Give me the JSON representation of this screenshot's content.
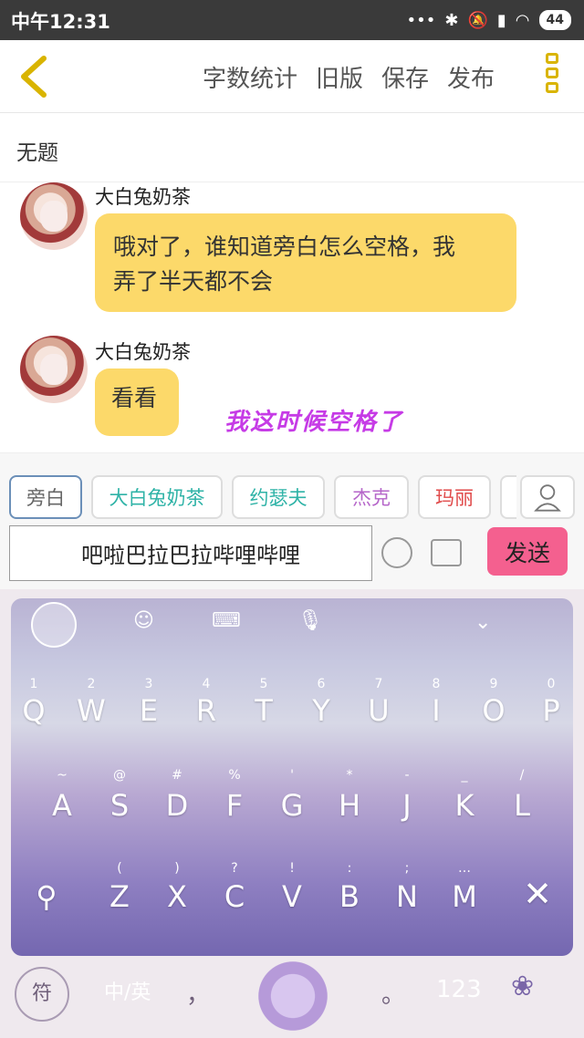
{
  "status": {
    "time": "中午12:31",
    "battery": "44"
  },
  "header": {
    "actions": [
      "字数统计",
      "旧版",
      "保存",
      "发布"
    ]
  },
  "doc_title": "无题",
  "messages": [
    {
      "name": "大白兔奶茶",
      "text_line1": "哦对了，谁知道旁白怎么空格，我",
      "text_line2": "弄了半天都不会"
    },
    {
      "name": "大白兔奶茶",
      "text_line1": "看看"
    }
  ],
  "annotation": "我这时候空格了",
  "roles": [
    {
      "label": "旁白",
      "color": "#666666"
    },
    {
      "label": "大白兔奶茶",
      "color": "#2fb3a7"
    },
    {
      "label": "约瑟夫",
      "color": "#2fb3a7"
    },
    {
      "label": "杰克",
      "color": "#b565c9"
    },
    {
      "label": "玛丽",
      "color": "#e04b4b"
    }
  ],
  "input": {
    "value": "吧啦巴拉巴拉哔哩哔哩"
  },
  "send_label": "发送",
  "keyboard": {
    "row1": [
      "Q",
      "W",
      "E",
      "R",
      "T",
      "Y",
      "U",
      "I",
      "O",
      "P"
    ],
    "row1_hints": [
      "1",
      "2",
      "3",
      "4",
      "5",
      "6",
      "7",
      "8",
      "9",
      "0"
    ],
    "row2": [
      "A",
      "S",
      "D",
      "F",
      "G",
      "H",
      "J",
      "K",
      "L"
    ],
    "row2_hints": [
      "~",
      "@",
      "#",
      "%",
      "'",
      "*",
      "-",
      "_",
      "/"
    ],
    "row3": [
      "Z",
      "X",
      "C",
      "V",
      "B",
      "N",
      "M"
    ],
    "row3_hints": [
      "(",
      ")",
      "?",
      "!",
      ":",
      ";",
      "…"
    ],
    "symbol_key": "符",
    "lang_key": "中/英",
    "comma": "，",
    "period": "。",
    "num_key": "123"
  }
}
